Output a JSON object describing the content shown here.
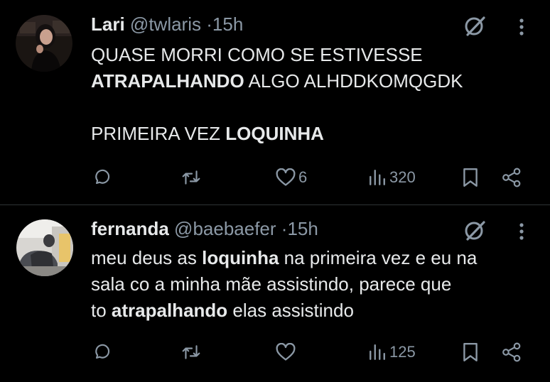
{
  "tweets": [
    {
      "name": "Lari",
      "handle": "@twlaris",
      "time": "15h",
      "dot": "·",
      "lines": [
        [
          {
            "text": "QUASE MORRI COMO SE ESTIVESSE",
            "bold": false
          }
        ],
        [
          {
            "text": "ATRAPALHANDO",
            "bold": true
          },
          {
            "text": " ALGO ALHDDKOMQGDK",
            "bold": false
          }
        ],
        [],
        [
          {
            "text": "PRIMEIRA VEZ ",
            "bold": false
          },
          {
            "text": "LOQUINHA",
            "bold": true
          }
        ]
      ],
      "stats": {
        "likes": "6",
        "views": "320"
      }
    },
    {
      "name": "fernanda",
      "handle": "@baebaefer",
      "time": "15h",
      "dot": "·",
      "lines": [
        [
          {
            "text": "meu deus as ",
            "bold": false
          },
          {
            "text": "loquinha",
            "bold": true
          },
          {
            "text": " na primeira vez e eu na",
            "bold": false
          }
        ],
        [
          {
            "text": "sala co a minha mãe assistindo, parece que",
            "bold": false
          }
        ],
        [
          {
            "text": "to ",
            "bold": false
          },
          {
            "text": "atrapalhando",
            "bold": true
          },
          {
            "text": " elas assistindo",
            "bold": false
          }
        ]
      ],
      "stats": {
        "likes": "",
        "views": "125"
      }
    }
  ],
  "icons": {
    "reply": "reply-icon",
    "retweet": "retweet-icon",
    "like": "heart-icon",
    "views": "views-icon",
    "bookmark": "bookmark-icon",
    "share": "share-icon",
    "grok": "grok-icon",
    "more": "more-icon"
  },
  "colors": {
    "background": "#000000",
    "text": "#e7e9ea",
    "muted": "#8b98a5",
    "divider": "#2f3336"
  }
}
